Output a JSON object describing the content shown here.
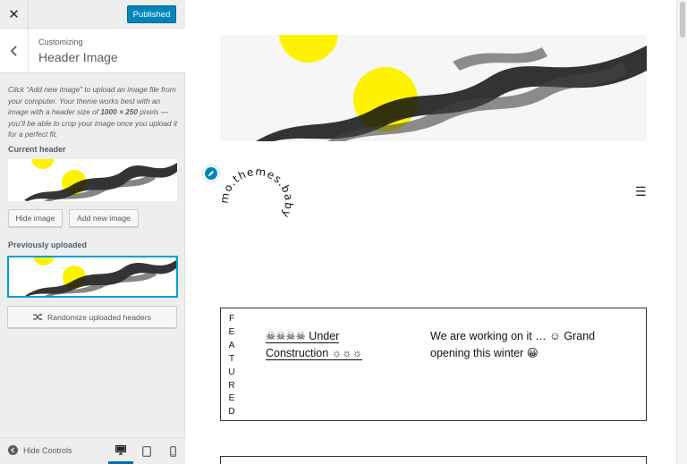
{
  "sidebar": {
    "close_icon": "✕",
    "publish_label": "Published",
    "section_kicker": "Customizing",
    "section_title": "Header Image",
    "help": {
      "part1": "Click “Add new image” to upload an image file from your computer. Your theme works best with an image with a header size of ",
      "size": "1000 × 250",
      "part2": " pixels — you’ll be able to crop your image once you upload it for a perfect fit."
    },
    "current_header_label": "Current header",
    "hide_image_label": "Hide image",
    "add_new_image_label": "Add new image",
    "previously_uploaded_label": "Previously uploaded",
    "randomize_label": "Randomize uploaded headers",
    "hide_controls_label": "Hide Controls",
    "accent_color": "#0085ba"
  },
  "preview": {
    "logo_text": "mo.themes.baby",
    "menu_icon": "☰",
    "featured": {
      "vertical_letters": [
        "F",
        "E",
        "A",
        "T",
        "U",
        "R",
        "E",
        "D"
      ],
      "link_text": "☠☠☠☠ Under Construction ☼☼☼",
      "body_text": "We are working on it … ☺ Grand opening this winter 😀"
    }
  },
  "colors": {
    "accent_yellow": "#fff200",
    "focus_blue": "#00a0d2"
  }
}
